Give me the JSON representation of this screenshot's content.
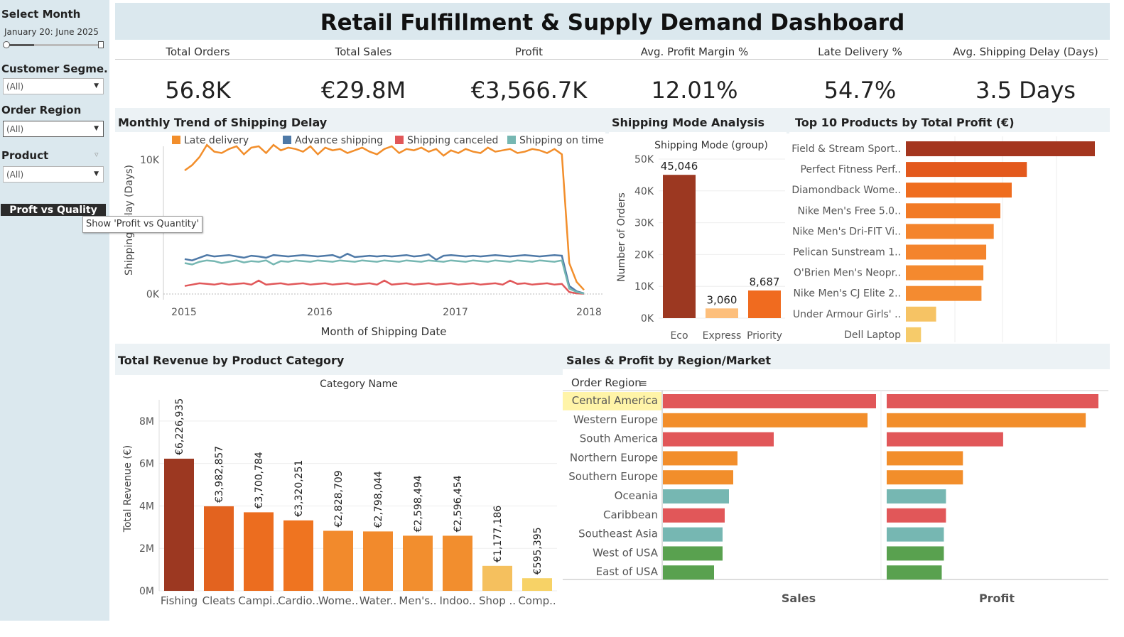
{
  "sidebar": {
    "select_month_label": "Select Month",
    "month_range": "January 20:  June 2025",
    "customer_segment_label": "Customer Segme..",
    "customer_segment_value": "(All)",
    "order_region_label": "Order Region",
    "order_region_value": "(All)",
    "product_label": "Product",
    "product_value": "(All)",
    "pvq_button_label": "Proft vs Quality",
    "tooltip": "Show 'Profit vs Quantity'"
  },
  "title": "Retail Fulfillment & Supply Demand Dashboard",
  "kpis": [
    {
      "label": "Total Orders",
      "value": "56.8K"
    },
    {
      "label": "Total Sales",
      "value": "€29.8M"
    },
    {
      "label": "Profit",
      "value": "€3,566.7K"
    },
    {
      "label": "Avg. Profit Margin %",
      "value": "12.01%"
    },
    {
      "label": "Late Delivery %",
      "value": "54.7%"
    },
    {
      "label": "Avg. Shipping Delay (Days)",
      "value": "3.5 Days"
    }
  ],
  "panels": {
    "trend_title": "Monthly Trend of Shipping Delay",
    "shipmode_title": "Shipping Mode Analysis",
    "top10_title": "Top 10 Products by Total Profit (€)",
    "revenue_title": "Total Revenue by Product Category",
    "region_title": "Sales & Profit by Region/Market"
  },
  "chart_data": [
    {
      "id": "trend",
      "type": "line",
      "title": "Monthly Trend of Shipping Delay",
      "xlabel": "Month of Shipping Date",
      "ylabel": "Shipping Delay (Days)",
      "x_ticks": [
        "2015",
        "2016",
        "2017",
        "2018"
      ],
      "y_ticks": [
        "0K",
        "10K"
      ],
      "ylim": [
        0,
        11000
      ],
      "legend": "top",
      "series": [
        {
          "name": "Late delivery",
          "color": "#f28e2b",
          "values": [
            9200,
            9600,
            10200,
            11100,
            10600,
            10500,
            10800,
            11000,
            10400,
            10900,
            11000,
            10500,
            11100,
            10700,
            10900,
            10800,
            10600,
            11000,
            10400,
            10900,
            10700,
            10800,
            10500,
            10700,
            10900,
            10600,
            10400,
            10800,
            11000,
            10500,
            10800,
            10700,
            10900,
            10600,
            10800,
            10300,
            10700,
            10500,
            10800,
            10600,
            10500,
            10900,
            10600,
            10700,
            10800,
            10500,
            10600,
            10800,
            10700,
            10500,
            10800,
            10400,
            2300,
            900,
            300
          ]
        },
        {
          "name": "Advance shipping",
          "color": "#4e79a7",
          "values": [
            2600,
            2500,
            2700,
            2900,
            2800,
            2850,
            2900,
            2800,
            2700,
            2850,
            2800,
            2700,
            2900,
            2850,
            2800,
            2850,
            2900,
            2850,
            2800,
            2850,
            2900,
            2700,
            3000,
            2750,
            2800,
            2850,
            2800,
            2850,
            2800,
            2850,
            2900,
            2800,
            2850,
            2950,
            2550,
            2850,
            2900,
            2850,
            2800,
            2850,
            2800,
            2850,
            2900,
            2850,
            2800,
            2850,
            2900,
            2850,
            2800,
            2850,
            2900,
            2850,
            600,
            200,
            50
          ]
        },
        {
          "name": "Shipping canceled",
          "color": "#e15759",
          "values": [
            600,
            700,
            800,
            750,
            700,
            800,
            700,
            750,
            800,
            700,
            1000,
            700,
            750,
            800,
            700,
            750,
            800,
            700,
            750,
            800,
            700,
            750,
            800,
            700,
            750,
            800,
            700,
            1000,
            700,
            750,
            800,
            700,
            750,
            800,
            700,
            750,
            800,
            700,
            750,
            800,
            700,
            750,
            800,
            700,
            1000,
            750,
            800,
            700,
            750,
            800,
            700,
            750,
            150,
            50,
            20
          ]
        },
        {
          "name": "Shipping on time",
          "color": "#76b7b2",
          "values": [
            2300,
            2200,
            2400,
            2500,
            2450,
            2300,
            2400,
            2500,
            2350,
            2450,
            2400,
            2500,
            2200,
            2450,
            2400,
            2500,
            2450,
            2400,
            2500,
            2450,
            2400,
            2500,
            2450,
            2400,
            2500,
            2450,
            2400,
            2500,
            2450,
            2400,
            2500,
            2450,
            2400,
            2500,
            2450,
            2400,
            2500,
            2450,
            2400,
            2500,
            2450,
            2400,
            2500,
            2450,
            2400,
            2500,
            2450,
            2400,
            2500,
            2450,
            2400,
            2500,
            400,
            150,
            30
          ]
        }
      ]
    },
    {
      "id": "shipmode",
      "type": "bar",
      "title": "Shipping Mode (group)",
      "ylabel": "Number of Orders",
      "y_ticks": [
        "0K",
        "10K",
        "20K",
        "30K",
        "40K",
        "50K"
      ],
      "ylim": [
        0,
        50000
      ],
      "categories": [
        "Eco",
        "Express",
        "Priority"
      ],
      "values": [
        45046,
        3060,
        8687
      ],
      "labels": [
        "45,046",
        "3,060",
        "8,687"
      ],
      "colors": [
        "#9c3821",
        "#fdbf7c",
        "#f06b1f"
      ]
    },
    {
      "id": "top10",
      "type": "bar",
      "orientation": "horizontal",
      "title": "Top 10 Products by Total Profit (€)",
      "categories": [
        "Field & Stream Sport..",
        "Perfect Fitness Perf..",
        "Diamondback Wome..",
        "Nike Men's Free 5.0..",
        "Nike Men's Dri-FIT Vi..",
        "Pelican Sunstream 1..",
        "O'Brien Men's Neopr..",
        "Nike Men's CJ Elite 2..",
        "Under Armour Girls' ..",
        "Dell Laptop"
      ],
      "values": [
        100,
        64,
        56,
        50,
        46.5,
        42.5,
        41,
        40,
        16,
        8
      ],
      "colors": [
        "#a4361f",
        "#e3591d",
        "#ef6d1f",
        "#f27a25",
        "#f4842c",
        "#f4842c",
        "#f4892e",
        "#f48b30",
        "#f6c364",
        "#f6cb6a"
      ]
    },
    {
      "id": "revenue",
      "type": "bar",
      "title": "Category Name",
      "ylabel": "Total Revenue (€)",
      "y_ticks": [
        "0M",
        "2M",
        "4M",
        "6M",
        "8M"
      ],
      "ylim": [
        0,
        9000000
      ],
      "categories": [
        "Fishing",
        "Cleats",
        "Campi..",
        "Cardio..",
        "Wome..",
        "Water..",
        "Men's..",
        "Indoo..",
        "Shop ..",
        "Comp.."
      ],
      "values": [
        6226935,
        3982857,
        3700784,
        3320251,
        2828709,
        2798044,
        2598494,
        2596454,
        1177186,
        595395
      ],
      "labels": [
        "€6,226,935",
        "€3,982,857",
        "€3,700,784",
        "€3,320,251",
        "€2,828,709",
        "€2,798,044",
        "€2,598,494",
        "€2,596,454",
        "€1,177,186",
        "€595,395"
      ],
      "colors": [
        "#9c3821",
        "#e3631f",
        "#ec6d1f",
        "#ef7420",
        "#f28a2c",
        "#f28a2c",
        "#f28e2e",
        "#f28e2e",
        "#f5c05e",
        "#f7d266"
      ]
    },
    {
      "id": "region",
      "type": "bar",
      "orientation": "horizontal",
      "title": "Sales & Profit by Region/Market",
      "row_header": "Order Region",
      "categories": [
        "Central America",
        "Western Europe",
        "South America",
        "Northern Europe",
        "Southern Europe",
        "Oceania",
        "Caribbean",
        "Southeast Asia",
        "West of USA",
        "East of USA"
      ],
      "highlighted": "Central America",
      "colors": [
        "#e15759",
        "#f28e2b",
        "#e15759",
        "#f28e2b",
        "#f28e2b",
        "#76b7b2",
        "#e15759",
        "#76b7b2",
        "#59a14f",
        "#59a14f"
      ],
      "series": [
        {
          "name": "Sales",
          "values": [
            100,
            96,
            52,
            35,
            33,
            31,
            29,
            28,
            28,
            24
          ]
        },
        {
          "name": "Profit",
          "values": [
            100,
            94,
            55,
            36,
            36,
            28,
            28,
            27,
            27,
            26
          ]
        }
      ]
    }
  ]
}
